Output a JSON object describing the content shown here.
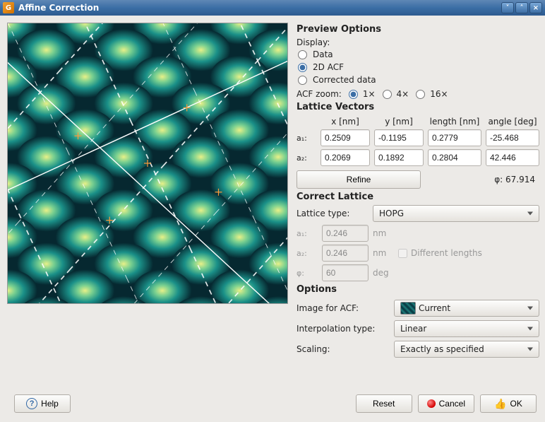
{
  "window": {
    "title": "Affine Correction"
  },
  "preview": {
    "title": "Preview Options",
    "display_label": "Display:",
    "options": {
      "data": "Data",
      "acf": "2D ACF",
      "corrected": "Corrected data"
    },
    "selected": "acf",
    "zoom_label": "ACF zoom:",
    "zoom_opts": {
      "z1": "1×",
      "z4": "4×",
      "z16": "16×"
    },
    "zoom_selected": "z1"
  },
  "lattice": {
    "title": "Lattice Vectors",
    "hdr": {
      "x": "x [nm]",
      "y": "y [nm]",
      "len": "length [nm]",
      "ang": "angle [deg]"
    },
    "a1_label": "a₁:",
    "a2_label": "a₂:",
    "a1": {
      "x": "0.2509",
      "y": "-0.1195",
      "len": "0.2779",
      "ang": "-25.468"
    },
    "a2": {
      "x": "0.2069",
      "y": "0.1892",
      "len": "0.2804",
      "ang": "42.446"
    },
    "refine": "Refine",
    "phi_label": "φ:",
    "phi": "67.914"
  },
  "correct": {
    "title": "Correct Lattice",
    "type_label": "Lattice type:",
    "type_value": "HOPG",
    "a1_label": "a₁:",
    "a1": "0.246",
    "a1_unit": "nm",
    "a2_label": "a₂:",
    "a2": "0.246",
    "a2_unit": "nm",
    "phi_label": "φ:",
    "phi": "60",
    "phi_unit": "deg",
    "diff_label": "Different lengths"
  },
  "options": {
    "title": "Options",
    "image_label": "Image for ACF:",
    "image_value": "Current",
    "interp_label": "Interpolation type:",
    "interp_value": "Linear",
    "scaling_label": "Scaling:",
    "scaling_value": "Exactly as specified"
  },
  "footer": {
    "help": "Help",
    "reset": "Reset",
    "cancel": "Cancel",
    "ok": "OK"
  }
}
